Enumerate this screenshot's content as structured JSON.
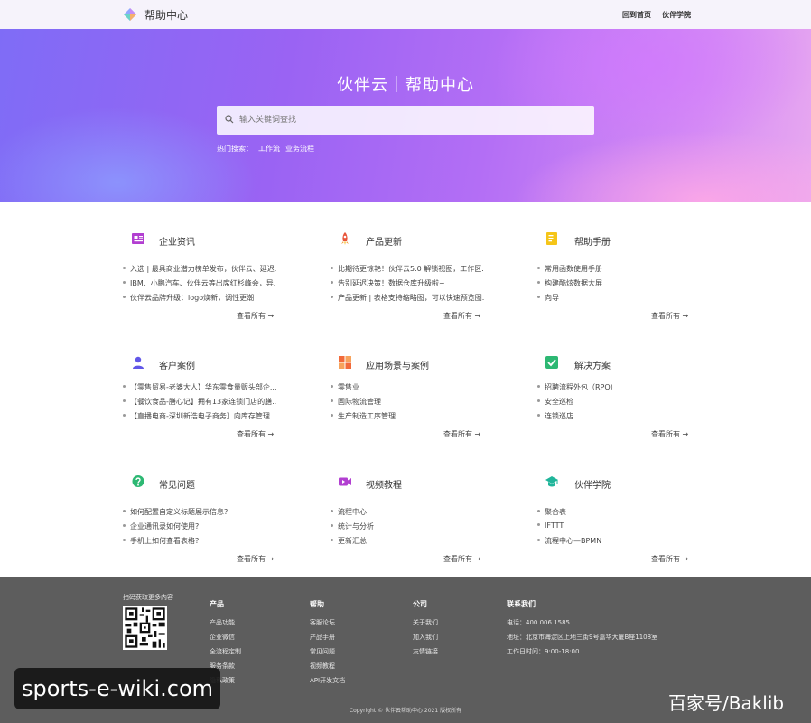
{
  "header": {
    "brand": "帮助中心",
    "nav": [
      "回到首页",
      "伙伴学院"
    ]
  },
  "hero": {
    "title": "伙伴云｜帮助中心",
    "search_placeholder": "输入关键词查找",
    "hot_label": "热门搜索：",
    "hot_items": [
      "工作流",
      "业务流程"
    ]
  },
  "cards": [
    {
      "icon": "news-icon",
      "title": "企业资讯",
      "items": [
        "入选 | 最具商业潜力榜单发布，伙伴云、延迟...",
        "IBM、小鹏汽车、伙伴云等出席红杉峰会，异...",
        "伙伴云品牌升级：logo焕新，调性更潮"
      ],
      "more": "查看所有 →"
    },
    {
      "icon": "rocket-icon",
      "title": "产品更新",
      "items": [
        "比期待更惊艳！伙伴云5.0 解锁视图，工作区...",
        "告别延迟决策！数据仓库升级啦~",
        "产品更新 | 表格支持缩略图，可以快速预览图..."
      ],
      "more": "查看所有 →"
    },
    {
      "icon": "manual-icon",
      "title": "帮助手册",
      "items": [
        "常用函数使用手册",
        "构建酷炫数据大屏",
        "向导"
      ],
      "more": "查看所有 →"
    },
    {
      "icon": "user-icon",
      "title": "客户案例",
      "items": [
        "【零售贸易-老婆大人】华东零食量贩头部企...",
        "【餐饮食品-膳心记】拥有13家连锁门店的膳...",
        "【直播电商-深圳新浩电子商务】向库存管理..."
      ],
      "more": "查看所有 →"
    },
    {
      "icon": "grid-icon",
      "title": "应用场景与案例",
      "items": [
        "零售业",
        "国际物流管理",
        "生产制造工序管理"
      ],
      "more": "查看所有 →"
    },
    {
      "icon": "check-icon",
      "title": "解决方案",
      "items": [
        "招聘流程外包（RPO）",
        "安全巡检",
        "连锁巡店"
      ],
      "more": "查看所有 →"
    },
    {
      "icon": "question-icon",
      "title": "常见问题",
      "items": [
        "如何配置自定义标题展示信息?",
        "企业通讯录如何使用?",
        "手机上如何查看表格?"
      ],
      "more": "查看所有 →"
    },
    {
      "icon": "video-icon",
      "title": "视频教程",
      "items": [
        "流程中心",
        "统计与分析",
        "更新汇总"
      ],
      "more": "查看所有 →"
    },
    {
      "icon": "graduation-cap-icon",
      "title": "伙伴学院",
      "items": [
        "聚合表",
        "IFTTT",
        "流程中心—BPMN"
      ],
      "more": "查看所有 →"
    }
  ],
  "footer": {
    "qr_label": "扫码获取更多内容",
    "product_head": "产品",
    "product_items": [
      "产品功能",
      "企业微信",
      "全流程定制",
      "服务条款",
      "隐私政策"
    ],
    "help_head": "帮助",
    "help_items": [
      "客服论坛",
      "产品手册",
      "常见问题",
      "视频教程",
      "API开发文档"
    ],
    "company_head": "公司",
    "company_items": [
      "关于我们",
      "加入我们",
      "友情链接"
    ],
    "contact_head": "联系我们",
    "contact_items": [
      "电话：400 006 1585",
      "地址：北京市海淀区上地三街9号嘉华大厦B座1108室",
      "工作日时间：9:00-18:00"
    ],
    "copyright": "Copyright © 伙伴云帮助中心 2021 版权所有"
  },
  "watermarks": {
    "left": "sports-e-wiki.com",
    "right": "百家号/Baklib"
  }
}
